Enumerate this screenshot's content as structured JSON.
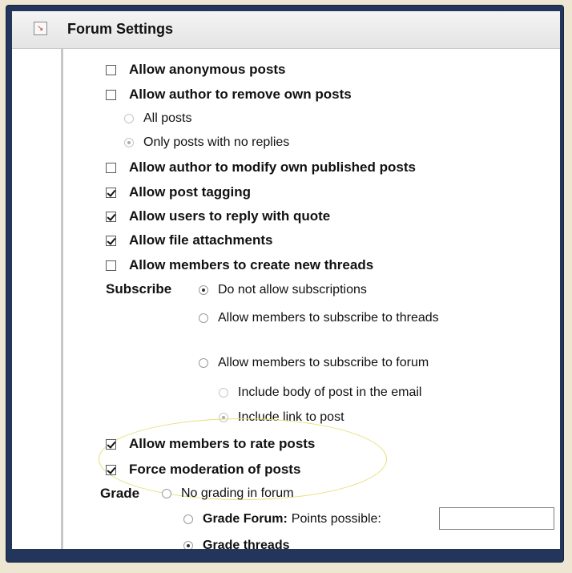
{
  "header": {
    "title": "Forum Settings"
  },
  "options": [
    {
      "label": "Allow anonymous posts",
      "checked": false
    },
    {
      "label": "Allow author to remove own posts",
      "checked": false
    },
    {
      "label": "Allow author to modify own published posts",
      "checked": false
    },
    {
      "label": "Allow post tagging",
      "checked": true
    },
    {
      "label": "Allow users to reply with quote",
      "checked": true
    },
    {
      "label": "Allow file attachments",
      "checked": true
    },
    {
      "label": "Allow members to create new threads",
      "checked": false
    },
    {
      "label": "Allow members to rate posts",
      "checked": true
    },
    {
      "label": "Force moderation of posts",
      "checked": true
    }
  ],
  "remove_posts": {
    "all": "All posts",
    "no_replies": "Only posts with no replies",
    "selected": "Only posts with no replies"
  },
  "subscribe": {
    "label": "Subscribe",
    "options": [
      "Do not allow subscriptions",
      "Allow members to subscribe to threads",
      "Allow members to subscribe to forum"
    ],
    "selected": "Do not allow subscriptions",
    "email": {
      "body": "Include body of post in the email",
      "link": "Include link to post",
      "selected": "Include link to post"
    }
  },
  "grade": {
    "label": "Grade",
    "no_grading": "No grading in forum",
    "grade_forum": "Grade Forum:",
    "points_label": "Points possible:",
    "points_value": "",
    "grade_threads": "Grade threads",
    "selected": "Grade threads"
  }
}
